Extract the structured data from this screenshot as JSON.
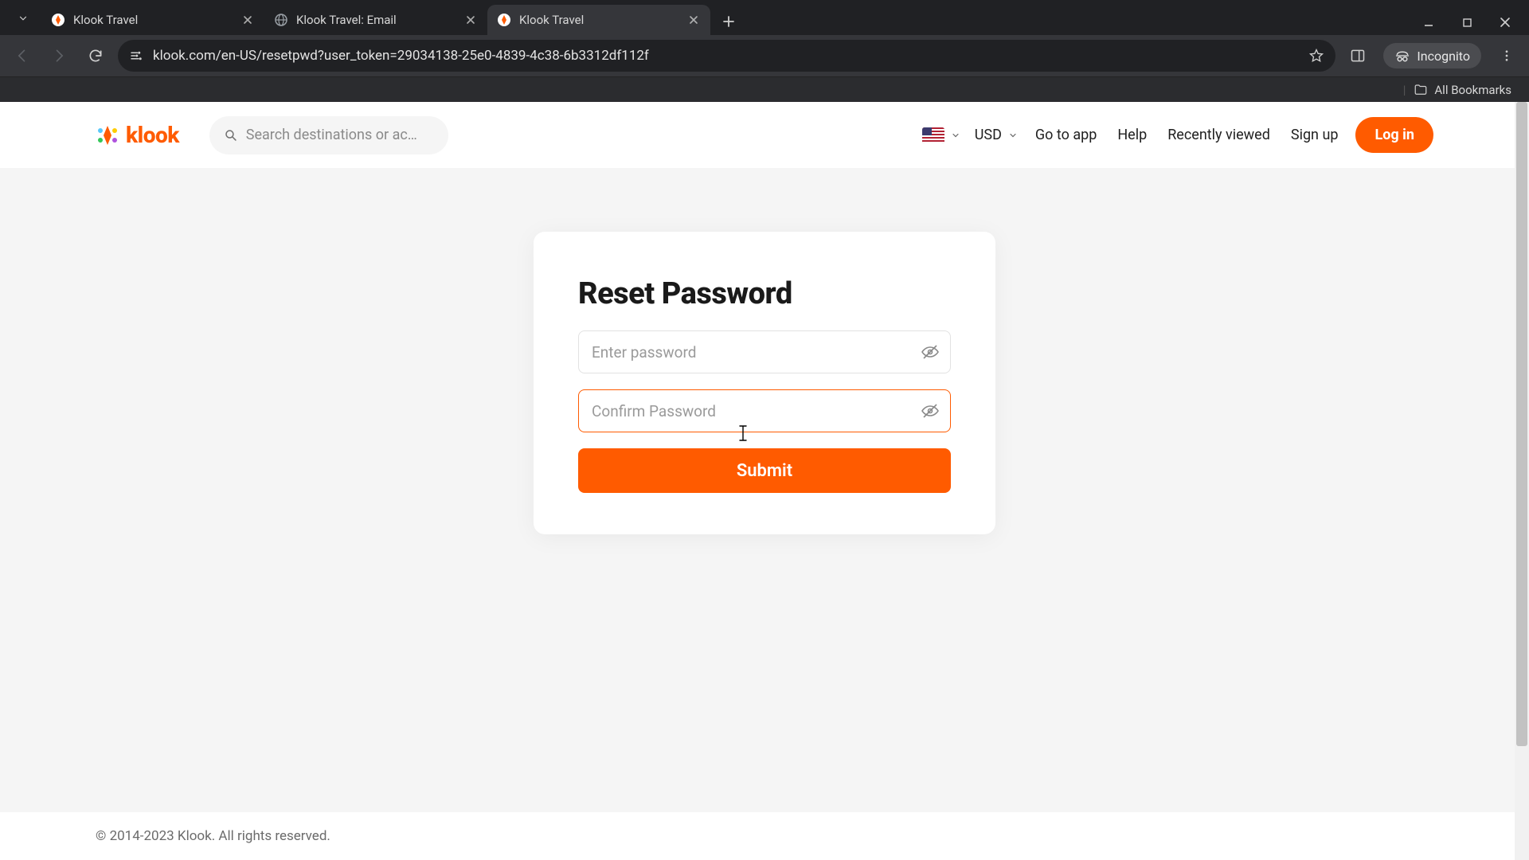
{
  "browser": {
    "tabs": [
      {
        "title": "Klook Travel",
        "active": false,
        "favicon": "klook"
      },
      {
        "title": "Klook Travel: Email",
        "active": false,
        "favicon": "globe"
      },
      {
        "title": "Klook Travel",
        "active": true,
        "favicon": "klook"
      }
    ],
    "url": "klook.com/en-US/resetpwd?user_token=29034138-25e0-4839-4c38-6b3312df112f",
    "incognito_label": "Incognito",
    "bookmarks_label": "All Bookmarks"
  },
  "nav": {
    "logo_text": "klook",
    "search_placeholder": "Search destinations or ac…",
    "currency": "USD",
    "links": {
      "go_to_app": "Go to app",
      "help": "Help",
      "recently_viewed": "Recently viewed",
      "sign_up": "Sign up",
      "log_in": "Log in"
    }
  },
  "form": {
    "title": "Reset Password",
    "password_placeholder": "Enter password",
    "confirm_placeholder": "Confirm Password",
    "submit_label": "Submit"
  },
  "footer": {
    "copyright": "© 2014-2023 Klook. All rights reserved."
  },
  "colors": {
    "accent": "#FF5B00"
  }
}
